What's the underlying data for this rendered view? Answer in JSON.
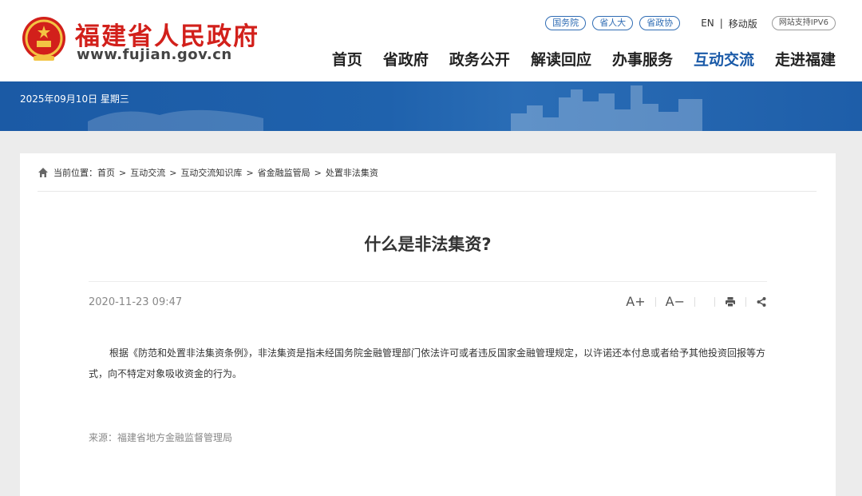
{
  "site": {
    "title": "福建省人民政府",
    "url": "www.fujian.gov.cn"
  },
  "top_links": {
    "pills": [
      "国务院",
      "省人大",
      "省政协"
    ],
    "lang": "EN",
    "separator": "|",
    "mobile": "移动版",
    "ipv6": "网站支持IPV6"
  },
  "nav": {
    "items": [
      {
        "label": "首页"
      },
      {
        "label": "省政府"
      },
      {
        "label": "政务公开"
      },
      {
        "label": "解读回应"
      },
      {
        "label": "办事服务"
      },
      {
        "label": "互动交流",
        "active": true
      },
      {
        "label": "走进福建"
      }
    ]
  },
  "banner": {
    "date": "2025年09月10日 星期三"
  },
  "breadcrumb": {
    "prefix": "当前位置：",
    "items": [
      "首页",
      "互动交流",
      "互动交流知识库",
      "省金融监管局",
      "处置非法集资"
    ],
    "separator": ">"
  },
  "article": {
    "title": "什么是非法集资?",
    "date": "2020-11-23 09:47",
    "font_increase": "A+",
    "font_decrease": "A−",
    "body": "根据《防范和处置非法集资条例》，非法集资是指未经国务院金融管理部门依法许可或者违反国家金融管理规定，以许诺还本付息或者给予其他投资回报等方式，向不特定对象吸收资金的行为。",
    "source": "来源：福建省地方金融监督管理局"
  },
  "colors": {
    "brand_red": "#d2201b",
    "nav_active": "#1a5aa8",
    "banner_blue": "#1b5aa5"
  }
}
